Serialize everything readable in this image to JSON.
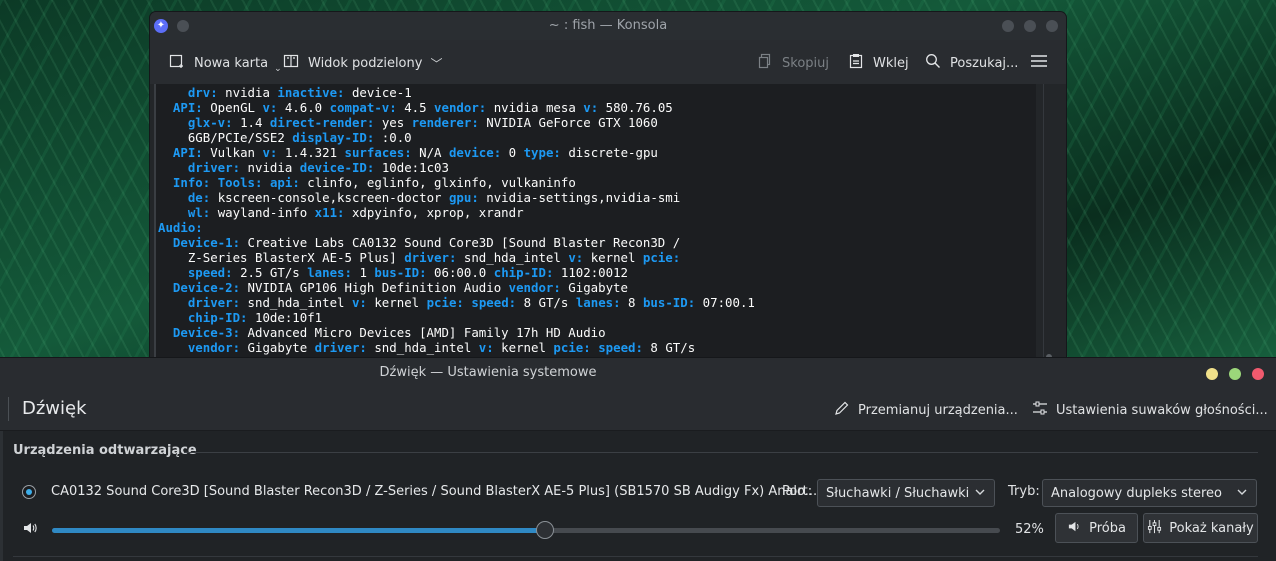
{
  "konsole": {
    "title": "~ : fish — Konsola",
    "toolbar": {
      "new_tab": "Nowa karta",
      "split_view": "Widok podzielony",
      "copy": "Skopiuj",
      "paste": "Wklej",
      "find": "Poszukaj..."
    },
    "terminal_lines": [
      [
        [
          "    ",
          ""
        ],
        [
          "drv:",
          "k"
        ],
        [
          " nvidia ",
          ""
        ],
        [
          "inactive:",
          "k"
        ],
        [
          " device-1",
          ""
        ]
      ],
      [
        [
          "  ",
          ""
        ],
        [
          "API:",
          "k"
        ],
        [
          " OpenGL ",
          ""
        ],
        [
          "v:",
          "k"
        ],
        [
          " 4.6.0 ",
          ""
        ],
        [
          "compat-v:",
          "k"
        ],
        [
          " 4.5 ",
          ""
        ],
        [
          "vendor:",
          "k"
        ],
        [
          " nvidia mesa ",
          ""
        ],
        [
          "v:",
          "k"
        ],
        [
          " 580.76.05",
          ""
        ]
      ],
      [
        [
          "    ",
          ""
        ],
        [
          "glx-v:",
          "k"
        ],
        [
          " 1.4 ",
          ""
        ],
        [
          "direct-render:",
          "k"
        ],
        [
          " yes ",
          ""
        ],
        [
          "renderer:",
          "k"
        ],
        [
          " NVIDIA GeForce GTX 1060",
          ""
        ]
      ],
      [
        [
          "    6GB/PCIe/SSE2 ",
          ""
        ],
        [
          "display-ID:",
          "k"
        ],
        [
          " :0.0",
          ""
        ]
      ],
      [
        [
          "  ",
          ""
        ],
        [
          "API:",
          "k"
        ],
        [
          " Vulkan ",
          ""
        ],
        [
          "v:",
          "k"
        ],
        [
          " 1.4.321 ",
          ""
        ],
        [
          "surfaces:",
          "k"
        ],
        [
          " N/A ",
          ""
        ],
        [
          "device:",
          "k"
        ],
        [
          " 0 ",
          ""
        ],
        [
          "type:",
          "k"
        ],
        [
          " discrete-gpu",
          ""
        ]
      ],
      [
        [
          "    ",
          ""
        ],
        [
          "driver:",
          "k"
        ],
        [
          " nvidia ",
          ""
        ],
        [
          "device-ID:",
          "k"
        ],
        [
          " 10de:1c03",
          ""
        ]
      ],
      [
        [
          "  ",
          ""
        ],
        [
          "Info:",
          "k"
        ],
        [
          " ",
          ""
        ],
        [
          "Tools:",
          "k"
        ],
        [
          " ",
          ""
        ],
        [
          "api:",
          "k"
        ],
        [
          " clinfo, eglinfo, glxinfo, vulkaninfo",
          ""
        ]
      ],
      [
        [
          "    ",
          ""
        ],
        [
          "de:",
          "k"
        ],
        [
          " kscreen-console,kscreen-doctor ",
          ""
        ],
        [
          "gpu:",
          "k"
        ],
        [
          " nvidia-settings,nvidia-smi",
          ""
        ]
      ],
      [
        [
          "    ",
          ""
        ],
        [
          "wl:",
          "k"
        ],
        [
          " wayland-info ",
          ""
        ],
        [
          "x11:",
          "k"
        ],
        [
          " xdpyinfo, xprop, xrandr",
          ""
        ]
      ],
      [
        [
          "Audio:",
          "k"
        ]
      ],
      [
        [
          "  ",
          ""
        ],
        [
          "Device-1:",
          "k"
        ],
        [
          " Creative Labs CA0132 Sound Core3D [Sound Blaster Recon3D /",
          ""
        ]
      ],
      [
        [
          "    Z-Series BlasterX AE-5 Plus] ",
          ""
        ],
        [
          "driver:",
          "k"
        ],
        [
          " snd_hda_intel ",
          ""
        ],
        [
          "v:",
          "k"
        ],
        [
          " kernel ",
          ""
        ],
        [
          "pcie:",
          "k"
        ]
      ],
      [
        [
          "    ",
          ""
        ],
        [
          "speed:",
          "k"
        ],
        [
          " 2.5 GT/s ",
          ""
        ],
        [
          "lanes:",
          "k"
        ],
        [
          " 1 ",
          ""
        ],
        [
          "bus-ID:",
          "k"
        ],
        [
          " 06:00.0 ",
          ""
        ],
        [
          "chip-ID:",
          "k"
        ],
        [
          " 1102:0012",
          ""
        ]
      ],
      [
        [
          "  ",
          ""
        ],
        [
          "Device-2:",
          "k"
        ],
        [
          " NVIDIA GP106 High Definition Audio ",
          ""
        ],
        [
          "vendor:",
          "k"
        ],
        [
          " Gigabyte",
          ""
        ]
      ],
      [
        [
          "    ",
          ""
        ],
        [
          "driver:",
          "k"
        ],
        [
          " snd_hda_intel ",
          ""
        ],
        [
          "v:",
          "k"
        ],
        [
          " kernel ",
          ""
        ],
        [
          "pcie:",
          "k"
        ],
        [
          " ",
          ""
        ],
        [
          "speed:",
          "k"
        ],
        [
          " 8 GT/s ",
          ""
        ],
        [
          "lanes:",
          "k"
        ],
        [
          " 8 ",
          ""
        ],
        [
          "bus-ID:",
          "k"
        ],
        [
          " 07:00.1",
          ""
        ]
      ],
      [
        [
          "    ",
          ""
        ],
        [
          "chip-ID:",
          "k"
        ],
        [
          " 10de:10f1",
          ""
        ]
      ],
      [
        [
          "  ",
          ""
        ],
        [
          "Device-3:",
          "k"
        ],
        [
          " Advanced Micro Devices [AMD] Family 17h HD Audio",
          ""
        ]
      ],
      [
        [
          "    ",
          ""
        ],
        [
          "vendor:",
          "k"
        ],
        [
          " Gigabyte ",
          ""
        ],
        [
          "driver:",
          "k"
        ],
        [
          " snd_hda_intel ",
          ""
        ],
        [
          "v:",
          "k"
        ],
        [
          " kernel ",
          ""
        ],
        [
          "pcie:",
          "k"
        ],
        [
          " ",
          ""
        ],
        [
          "speed:",
          "k"
        ],
        [
          " 8 GT/s",
          ""
        ]
      ]
    ],
    "colors": {
      "key": "#1d99f3",
      "text": "#fcfcfc",
      "background": "#1c1e21"
    }
  },
  "settings": {
    "title": "Dźwięk — Ustawienia systemowe",
    "page_title": "Dźwięk",
    "rename_devices": "Przemianuj urządzenia...",
    "volume_slider_settings": "Ustawienia suwaków głośności...",
    "section_heading": "Urządzenia odtwarzające",
    "device": {
      "name": "CA0132 Sound Core3D [Sound Blaster Recon3D / Z-Series / Sound BlasterX AE-5 Plus] (SB1570 SB Audigy Fx) Analo...",
      "selected": true,
      "port_label": "Port:",
      "port_value": "Słuchawki / Słuchawki",
      "mode_label": "Tryb:",
      "mode_value": "Analogowy dupleks stereo",
      "volume_percent": 52,
      "volume_text": "52%",
      "test_button": "Próba",
      "show_channels_button": "Pokaż kanały"
    },
    "window_button_colors": {
      "minimize": "#f0e08a",
      "maximize": "#9bd77a",
      "close": "#f05a6e"
    },
    "accent": "#3daee9"
  }
}
